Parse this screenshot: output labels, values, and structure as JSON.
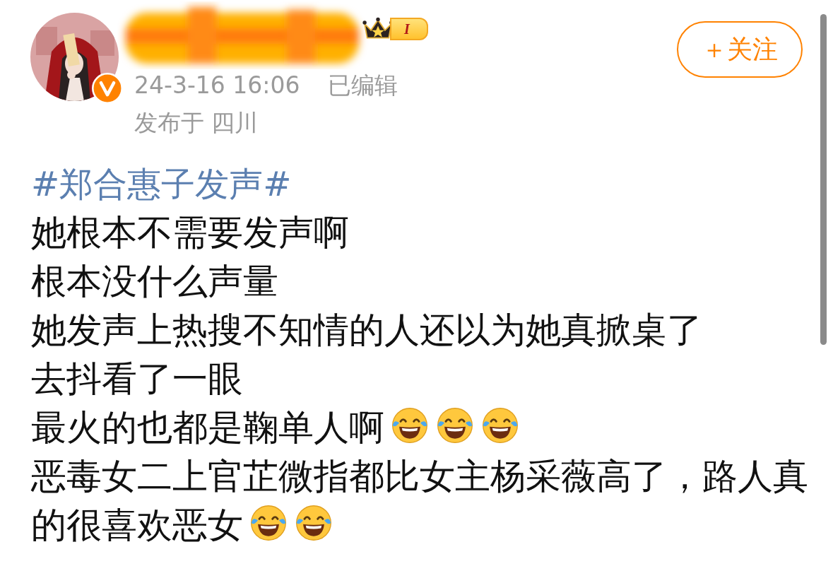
{
  "author": {
    "verified": true,
    "level_badge": "I",
    "time": "24-3-16 16:06",
    "edited": "已编辑",
    "location": "发布于 四川"
  },
  "follow_button": {
    "label": "＋关注"
  },
  "post": {
    "hashtag": "#郑合惠子发声#",
    "lines": [
      {
        "text": "她根本不需要发声啊"
      },
      {
        "text": "根本没什么声量"
      },
      {
        "text": "她发声上热搜不知情的人还以为她真掀桌了"
      },
      {
        "text": "去抖看了一眼"
      },
      {
        "text": "最火的也都是鞠单人啊",
        "emojis": [
          {
            "kind": "laugh-cry"
          },
          {
            "kind": "laugh-cry"
          },
          {
            "kind": "laugh-cry"
          }
        ]
      },
      {
        "text": "恶毒女二上官芷微指都比女主杨采薇高了，路人真的很喜欢恶女",
        "emojis": [
          {
            "kind": "laugh-cry"
          },
          {
            "kind": "laugh-cry"
          }
        ]
      }
    ]
  }
}
